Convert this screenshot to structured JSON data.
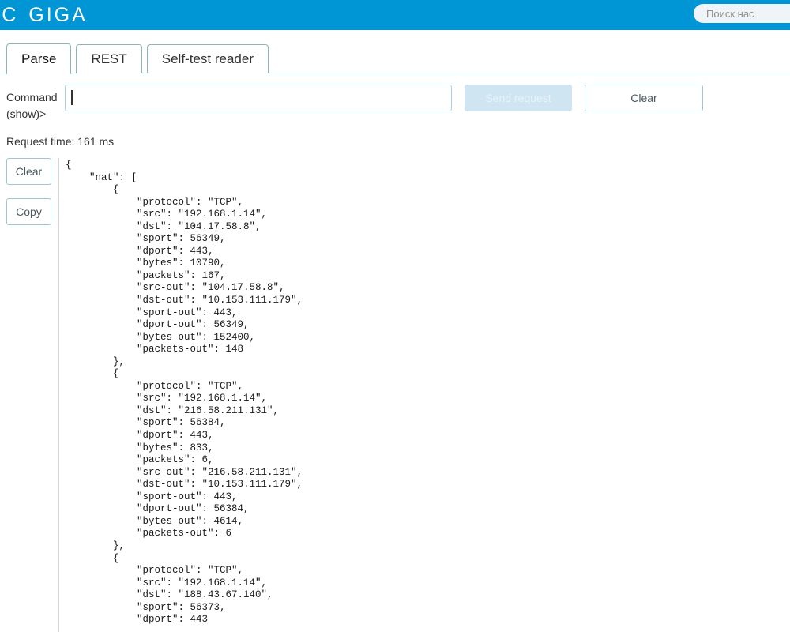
{
  "header": {
    "logo_part1": "TIC",
    "logo_part2": "GIGA",
    "brand_color": "#0095d5",
    "search": {
      "placeholder": "Поиск нас",
      "icon": "search-icon"
    }
  },
  "tabs": [
    {
      "label": "Parse",
      "active": true
    },
    {
      "label": "REST",
      "active": false
    },
    {
      "label": "Self-test reader",
      "active": false
    }
  ],
  "command": {
    "label_line1": "Command",
    "label_line2": "(show)>",
    "value": "",
    "placeholder": "",
    "send_label": "Send request",
    "send_disabled": true,
    "clear_label": "Clear"
  },
  "status": {
    "request_time": "Request time: 161 ms"
  },
  "sidebar": {
    "clear_label": "Clear",
    "copy_label": "Copy"
  },
  "output": {
    "text": "{\n    \"nat\": [\n        {\n            \"protocol\": \"TCP\",\n            \"src\": \"192.168.1.14\",\n            \"dst\": \"104.17.58.8\",\n            \"sport\": 56349,\n            \"dport\": 443,\n            \"bytes\": 10790,\n            \"packets\": 167,\n            \"src-out\": \"104.17.58.8\",\n            \"dst-out\": \"10.153.111.179\",\n            \"sport-out\": 443,\n            \"dport-out\": 56349,\n            \"bytes-out\": 152400,\n            \"packets-out\": 148\n        },\n        {\n            \"protocol\": \"TCP\",\n            \"src\": \"192.168.1.14\",\n            \"dst\": \"216.58.211.131\",\n            \"sport\": 56384,\n            \"dport\": 443,\n            \"bytes\": 833,\n            \"packets\": 6,\n            \"src-out\": \"216.58.211.131\",\n            \"dst-out\": \"10.153.111.179\",\n            \"sport-out\": 443,\n            \"dport-out\": 56384,\n            \"bytes-out\": 4614,\n            \"packets-out\": 6\n        },\n        {\n            \"protocol\": \"TCP\",\n            \"src\": \"192.168.1.14\",\n            \"dst\": \"188.43.67.140\",\n            \"sport\": 56373,\n            \"dport\": 443"
  }
}
